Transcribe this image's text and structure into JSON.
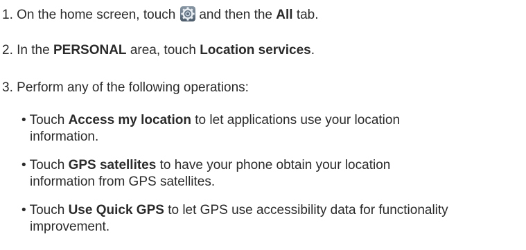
{
  "steps": [
    {
      "number": "1.",
      "text_before": "On the home screen, touch",
      "icon": "settings-gear-icon",
      "text_middle": "and then the",
      "bold": "All",
      "text_after": "tab."
    },
    {
      "number": "2.",
      "text_before": "In the",
      "bold1": "PERSONAL",
      "text_middle": "area, touch",
      "bold2": "Location services",
      "text_after": "."
    },
    {
      "number": "3.",
      "text": "Perform any of the following operations:"
    }
  ],
  "bullets": [
    {
      "marker": "•",
      "prefix": "Touch",
      "bold": "Access my location",
      "line1_rest": "to let applications use your location",
      "line2": "information."
    },
    {
      "marker": "•",
      "prefix": "Touch",
      "bold": "GPS satellites",
      "line1_rest": "to have your phone obtain your location",
      "line2": "information from GPS satellites."
    },
    {
      "marker": "•",
      "prefix": "Touch",
      "bold": "Use Quick GPS",
      "line1_rest": "to let GPS use accessibility data for functionality",
      "line2": "improvement."
    }
  ],
  "colors": {
    "text": "#2a2a2a",
    "icon_outer": "#5d6d7d",
    "icon_inner": "#dfe8f0"
  }
}
